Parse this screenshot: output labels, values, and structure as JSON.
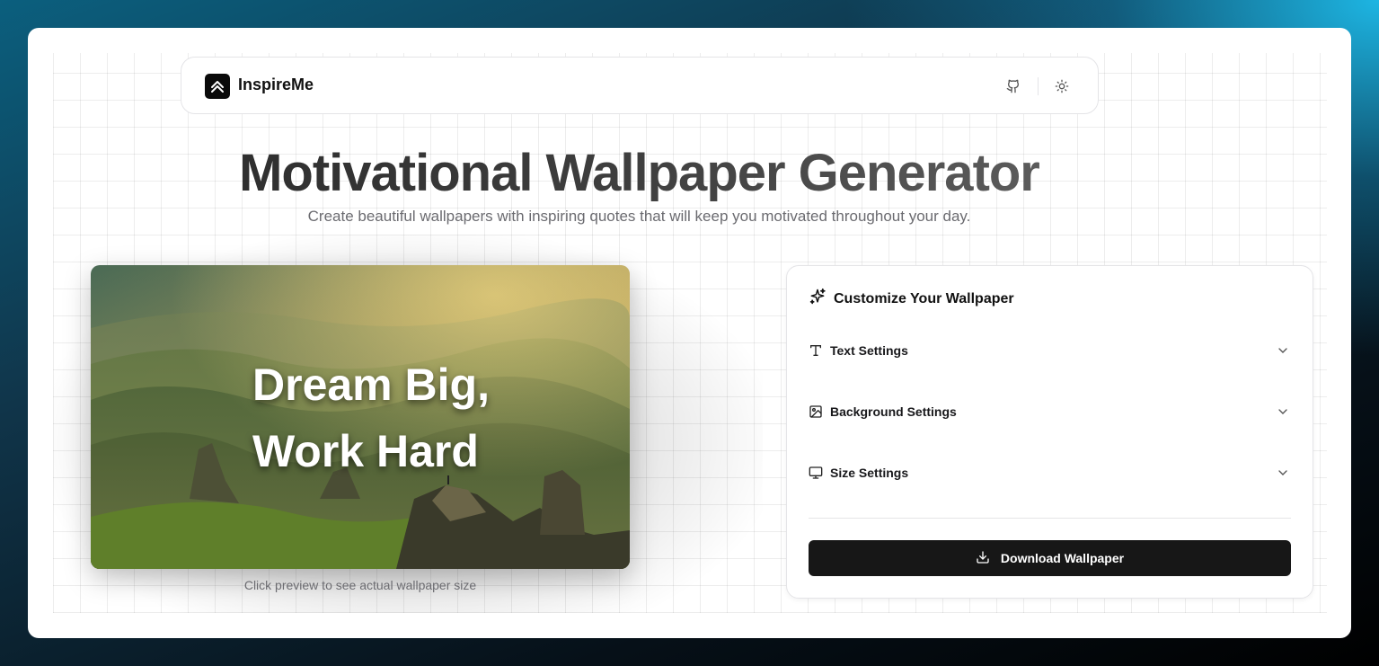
{
  "brand": {
    "name": "InspireMe",
    "logo_icon": "chevrons-up-icon"
  },
  "nav": {
    "github_icon": "github-icon",
    "theme_icon": "sun-icon"
  },
  "hero": {
    "title": "Motivational Wallpaper Generator",
    "subtitle": "Create beautiful wallpapers with inspiring quotes that will keep you motivated throughout your day."
  },
  "preview": {
    "quote_line1": "Dream Big,",
    "quote_line2": "Work Hard",
    "caption": "Click preview to see actual wallpaper size"
  },
  "panel": {
    "title": "Customize Your Wallpaper",
    "title_icon": "sparkles-icon",
    "sections": [
      {
        "label": "Text Settings",
        "icon": "text-type-icon"
      },
      {
        "label": "Background Settings",
        "icon": "image-icon"
      },
      {
        "label": "Size Settings",
        "icon": "monitor-icon"
      }
    ],
    "download_label": "Download Wallpaper",
    "download_icon": "download-icon"
  },
  "colors": {
    "accent_dark": "#171717",
    "border": "#e4e4e7",
    "muted_text": "#6b6b70"
  }
}
